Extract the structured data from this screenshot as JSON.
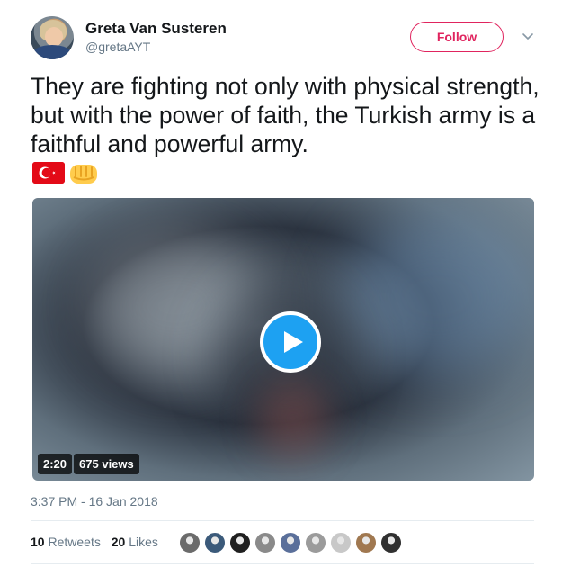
{
  "author": {
    "name": "Greta Van Susteren",
    "handle": "@gretaAYT"
  },
  "follow_label": "Follow",
  "tweet": {
    "text": "They are fighting not only with physical strength, but with the power of faith, the Turkish army is a faithful and powerful army.",
    "emojis": [
      "turkey-flag",
      "oncoming-fist"
    ]
  },
  "video": {
    "duration": "2:20",
    "views": "675 views"
  },
  "timestamp": "3:37 PM - 16 Jan 2018",
  "stats": {
    "retweets_count": "10",
    "retweets_label": "Retweets",
    "likes_count": "20",
    "likes_label": "Likes"
  },
  "likers": [
    {
      "color": "#6b6b6b"
    },
    {
      "color": "#3b5a7a"
    },
    {
      "color": "#1f1f1f"
    },
    {
      "color": "#8a8a8a"
    },
    {
      "color": "#5a6f9a"
    },
    {
      "color": "#9b9b9b"
    },
    {
      "color": "#c8c8c8"
    },
    {
      "color": "#a07850"
    },
    {
      "color": "#303030"
    }
  ],
  "colors": {
    "accent": "#1da1f2",
    "follow": "#e0245e",
    "muted": "#657786"
  }
}
